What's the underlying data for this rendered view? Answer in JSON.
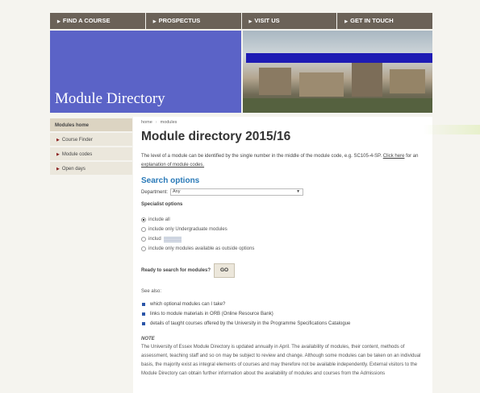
{
  "topnav": [
    "FIND A COURSE",
    "PROSPECTUS",
    "VISIT US",
    "GET IN TOUCH"
  ],
  "banner": {
    "title": "Module Directory"
  },
  "sidebar": [
    "Modules home",
    "Course Finder",
    "Module codes",
    "Open days"
  ],
  "breadcrumb": {
    "home": "home",
    "current": "modules"
  },
  "page_title": "Module directory 2015/16",
  "intro": {
    "text": "The level of a module can be identified by the single number in the middle of the module code, e.g. SC105-4-SP.",
    "link1": "Click here",
    "text2": "for an",
    "link2": "explanation of module codes."
  },
  "search": {
    "heading": "Search options",
    "department_label": "Department:",
    "department_value": "Any",
    "specialist_label": "Specialist options",
    "options": [
      "include all",
      "include only Undergraduate modules",
      "includ",
      "include only modules available as outside options"
    ],
    "ready_label": "Ready to search for modules?",
    "go_label": "GO"
  },
  "see_also": {
    "label": "See also:",
    "links": [
      "which optional modules can I take?",
      "links to module materials in ORB (Online Resource Bank)",
      "details of taught courses offered by the University in the Programme Specifications Catalogue"
    ]
  },
  "note": {
    "heading": "NOTE",
    "text": "The University of Essex Module Directory is updated annually in April. The availability of modules, their content, methods of assessment, teaching staff and so on may be subject to review and change. Although some modules can be taken on an individual basis, the majority exist as integral elements of courses and may therefore not be available independently. External visitors to the Module Directory can obtain further information about the availability of modules and courses from the Admissions"
  }
}
